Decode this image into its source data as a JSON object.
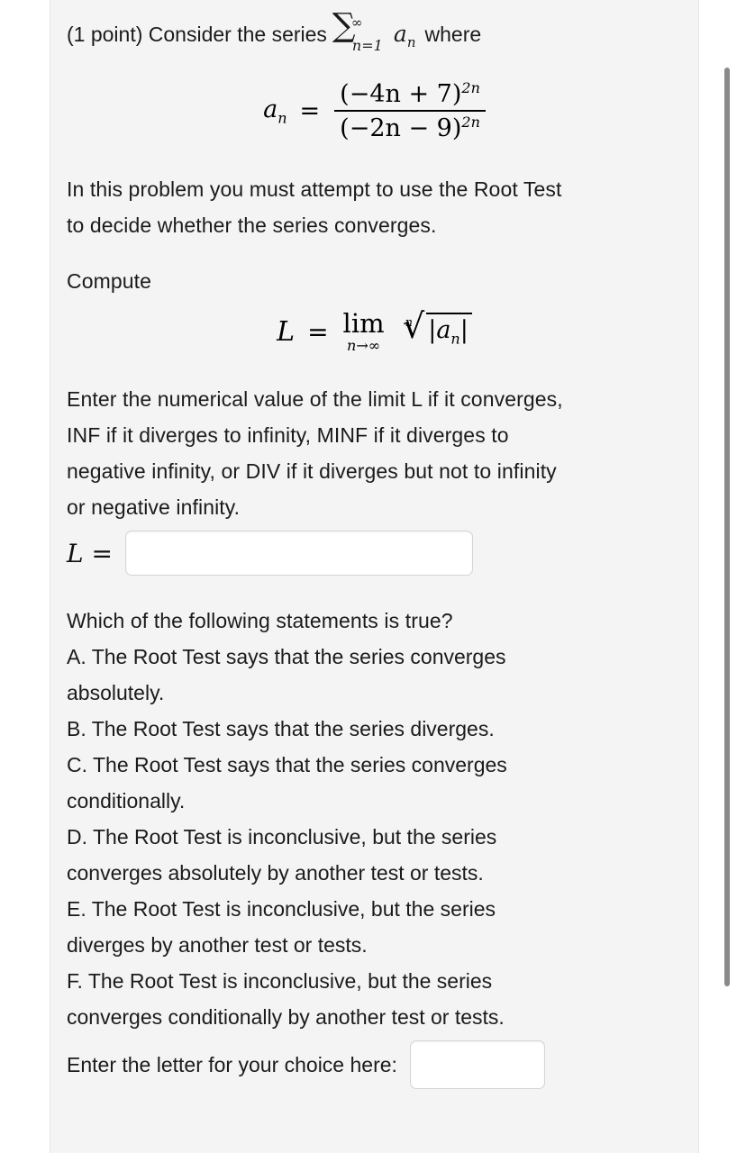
{
  "problem": {
    "points_label": "(1 point)",
    "intro_text": "Consider the series",
    "intro_tail": "where",
    "sum": {
      "sigma": "∑",
      "upper": "∞",
      "lower": "n=1",
      "term": "a",
      "term_sub": "n"
    },
    "definition": {
      "lhs": "a",
      "lhs_sub": "n",
      "equals": "=",
      "numerator": "(−4n + 7)",
      "numerator_exp": "2n",
      "denominator": "(−2n − 9)",
      "denominator_exp": "2n"
    },
    "instruction_line_1": "In this problem you must attempt to use the Root Test",
    "instruction_line_2": "to decide whether the series converges.",
    "compute_label": "Compute",
    "limit_formula": {
      "L": "L",
      "equals": "=",
      "lim": "lim",
      "lim_sub": "n→∞",
      "root_index": "n",
      "radical_sign": "√",
      "radicand_left": "|",
      "radicand_base": "a",
      "radicand_sub": "n",
      "radicand_right": "|"
    },
    "enter_value_line_1": "Enter the numerical value of the limit L if it converges,",
    "enter_value_line_2": "INF if it diverges to infinity, MINF if it diverges to",
    "enter_value_line_3": "negative infinity, or DIV if it diverges but not to infinity",
    "enter_value_line_4": "or negative infinity.",
    "limit_answer": {
      "label": "L =",
      "value": "",
      "placeholder": ""
    },
    "mc_question": "Which of the following statements is true?",
    "options": [
      "A. The Root Test says that the series converges",
      "absolutely.",
      "B. The Root Test says that the series diverges.",
      "C. The Root Test says that the series converges",
      "conditionally.",
      "D. The Root Test is inconclusive, but the series",
      "converges absolutely by another test or tests.",
      "E. The Root Test is inconclusive, but the series",
      "diverges by another test or tests.",
      "F. The Root Test is inconclusive, but the series",
      "converges conditionally by another test or tests."
    ],
    "choice_answer": {
      "label": "Enter the letter for your choice here:",
      "value": "",
      "placeholder": ""
    }
  },
  "colors": {
    "panel_background": "#f4f4f4",
    "page_background": "#ffffff",
    "text": "#1b1b1b",
    "input_border": "#d4d4d4",
    "scrollbar_thumb": "#8a8a8a"
  }
}
